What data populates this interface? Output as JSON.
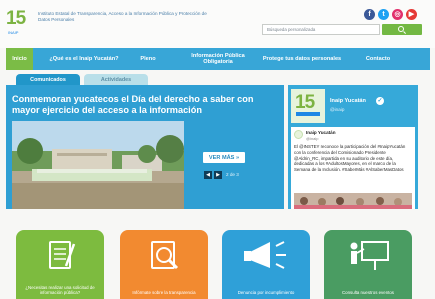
{
  "header": {
    "logo_number": "15",
    "logo_caption": "INAIP",
    "institute_name": "Instituto Estatal de Transparencia, Acceso a la Información Pública y Protección de Datos Personales",
    "institute_sub": "",
    "search_placeholder": "Búsqueda personalizada"
  },
  "social": {
    "facebook": "f",
    "twitter": "t",
    "instagram": "◎",
    "youtube": "▶"
  },
  "nav": {
    "home": "Inicio",
    "item_1": "¿Qué es el Inaip Yucatán?",
    "item_2": "Pleno",
    "item_3": "Información Pública Obligatoria",
    "item_4": "Protege tus datos personales",
    "item_5": "Contacto"
  },
  "tabs": {
    "communicados": "Comunicados",
    "activities": "Actividades"
  },
  "news": {
    "title": "Conmemoran yucatecos el Día del derecho a saber con mayor ejercicio del acceso a la información",
    "more_button": "VER MÁS »",
    "prev": "◀",
    "next": "▶",
    "pager": "2 de 3"
  },
  "twitter": {
    "account_name": "Inaip Yucatán",
    "verified": "✓",
    "handle": "@inaip",
    "card_name": "Inaip Yucatán",
    "card_handle": "@inaip",
    "tweet_text": "El @INSTEY reconoce la participación del #InaipYucatán con la conferencia del Comisionado Presidente @Aldrin_RC, impartida en su auditorio de este día, dedicadas a los #AdultosMayores, en el marco de la Semana de la Inclusión. #SaberMás #AlSaberMasDatos"
  },
  "tiles": [
    {
      "label": "¿Necesitas realizar una solicitud de información pública?",
      "color": "#7dbb3f"
    },
    {
      "label": "Infórmate sobre la transparencia",
      "color": "#f28a30"
    },
    {
      "label": "Denuncia por incumplimiento",
      "color": "#2fa0d8"
    },
    {
      "label": "Consulta nuestros eventos",
      "color": "#4a9c62"
    }
  ]
}
